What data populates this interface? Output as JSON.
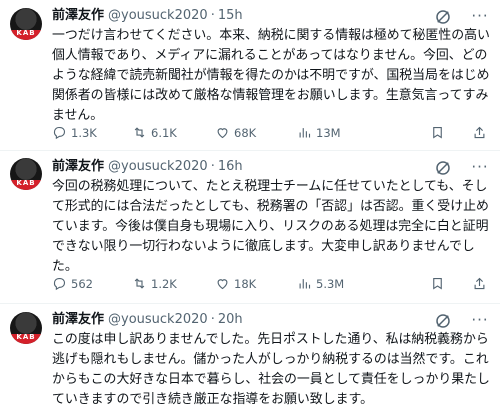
{
  "tweets": [
    {
      "author": "前澤友作",
      "handle": "@yousuck2020",
      "time": "15h",
      "avatar_text": "KAB",
      "text": "一つだけ言わせてください。本来、納税に関する情報は極めて秘匿性の高い個人情報であり、メディアに漏れることがあってはなりません。今回、どのような経緯で読売新聞社が情報を得たのかは不明ですが、国税当局をはじめ関係者の皆様には改めて厳格な情報管理をお願いします。生意気言ってすみません。",
      "replies": "1.3K",
      "reposts": "6.1K",
      "likes": "68K",
      "views": "13M"
    },
    {
      "author": "前澤友作",
      "handle": "@yousuck2020",
      "time": "16h",
      "avatar_text": "KAB",
      "text": "今回の税務処理について、たとえ税理士チームに任せていたとしても、そして形式的には合法だったとしても、税務署の「否認」は否認。重く受け止めています。今後は僕自身も現場に入り、リスクのある処理は完全に白と証明できない限り一切行わないように徹底します。大変申し訳ありませんでした。",
      "replies": "562",
      "reposts": "1.2K",
      "likes": "18K",
      "views": "5.3M"
    },
    {
      "author": "前澤友作",
      "handle": "@yousuck2020",
      "time": "20h",
      "avatar_text": "KAB",
      "text": "この度は申し訳ありませんでした。先日ポストした通り、私は納税義務から逃げも隠れもしません。儲かった人がしっかり納税するのは当然です。これからもこの大好きな日本で暮らし、社会の一員として責任をしっかり果たしていきますので引き続き厳正な指導をお願い致します。",
      "replies": "",
      "reposts": "",
      "likes": "",
      "views": ""
    }
  ],
  "colors": {
    "text": "#0f1419",
    "secondary": "#536471",
    "divider": "#eff3f4",
    "avatar_band": "#d4202a"
  },
  "icons": [
    "grok-icon",
    "more-icon",
    "reply-icon",
    "repost-icon",
    "like-icon",
    "views-icon",
    "bookmark-icon",
    "share-icon"
  ]
}
